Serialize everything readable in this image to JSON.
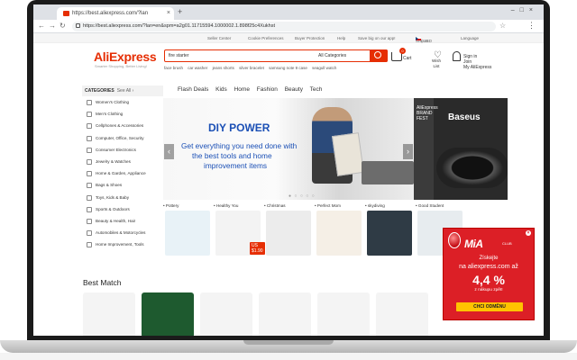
{
  "browser": {
    "tab_title": "https://best.aliexpress.com/?lan",
    "url": "https://best.aliexpress.com/?lan=en&spm=a2g01.11715594.1000002.1.898f25c4Xukhst"
  },
  "topbar": {
    "seller_center": "Seller Center",
    "cookie_prefs": "Cookie Preferences",
    "buyer_protection": "Buyer Protection",
    "help": "Help",
    "save_app": "Save big on our app!",
    "ship_to": "Ship to",
    "currency": "/ USD",
    "language": "Language"
  },
  "header": {
    "logo": "AliExpress",
    "tagline": "Smarter Shopping, Better Living!",
    "search_value": "fire starter",
    "search_category": "All Categories",
    "hot_words": [
      "face brush",
      "car washer",
      "jeans shorts",
      "silver bracelet",
      "samsung note 9 case",
      "seagull watch"
    ],
    "cart_count": "0",
    "cart_label": "Cart",
    "wish_line1": "Wish",
    "wish_line2": "List",
    "sign_line1": "Sign in",
    "sign_line2": "Join",
    "sign_line3": "My AliExpress"
  },
  "categories": {
    "header": "CATEGORIES",
    "see_all": "See All ›",
    "items": [
      "Women's Clothing",
      "Men's Clothing",
      "Cellphones & Accessories",
      "Computer, Office, Security",
      "Consumer Electronics",
      "Jewelry & Watches",
      "Home & Garden, Appliance",
      "Bags & Shoes",
      "Toys, Kids & Baby",
      "Sports & Outdoors",
      "Beauty & Health, Hair",
      "Automobiles & Motorcycles",
      "Home Improvement, Tools"
    ]
  },
  "nav": [
    "Flash Deals",
    "Kids",
    "Home",
    "Fashion",
    "Beauty",
    "Tech"
  ],
  "banner": {
    "title": "DIY POWER",
    "line1": "Get everything you need done with",
    "line2": "the best tools and home",
    "line3": "improvement items"
  },
  "side_banner": {
    "brand_line1": "AliExpress",
    "brand_line2": "BRAND",
    "brand_line3": "FEST",
    "brand_name": "Baseus"
  },
  "tiles": [
    {
      "label": "• Pottery",
      "color": "#e8f2f7"
    },
    {
      "label": "• Healthy You",
      "color": "#f3f3f3",
      "price": "US $1.90"
    },
    {
      "label": "• Christmas",
      "color": "#ececec"
    },
    {
      "label": "• Perfect Mom",
      "color": "#f5efe6"
    },
    {
      "label": "• skydiving",
      "color": "#2f3b45"
    },
    {
      "label": "• Good Student",
      "color": "#e7ecef"
    }
  ],
  "best_match": {
    "title": "Best Match"
  },
  "mia": {
    "logo": "MiA",
    "club": "CLUB",
    "line1": "Získejte",
    "line2": "na aliexpress.com až",
    "percent": "4,4 %",
    "line3": "z nákupu zpět!",
    "button": "CHCI ODMĚNU",
    "close": "×",
    "accent": "#dc1f26"
  }
}
